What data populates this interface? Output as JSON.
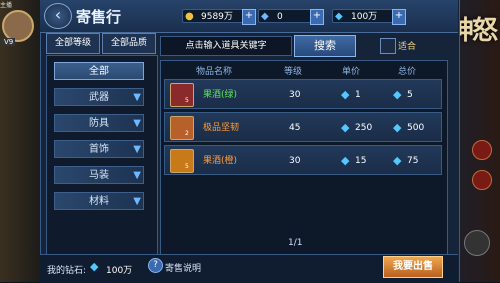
{
  "window": {
    "title": "寄售行"
  },
  "currencies": [
    {
      "icon": "gold-coin-icon",
      "value": "9589万"
    },
    {
      "icon": "blue-gem-icon",
      "value": "0"
    },
    {
      "icon": "diamond-icon",
      "value": "100万"
    }
  ],
  "filters": {
    "level": "全部等级",
    "quality": "全部品质"
  },
  "categories": [
    {
      "label": "全部",
      "selected": true
    },
    {
      "label": "武器"
    },
    {
      "label": "防具"
    },
    {
      "label": "首饰"
    },
    {
      "label": "马装"
    },
    {
      "label": "材料"
    }
  ],
  "search": {
    "placeholder": "点击输入道具关键字",
    "button": "搜索",
    "check_label": "适合"
  },
  "table": {
    "headers": [
      "物品名称",
      "等级",
      "单价",
      "总价"
    ],
    "rows": [
      {
        "name": "果酒(绿)",
        "level": "30",
        "unit": "1",
        "total": "5",
        "count": "5",
        "name_color": "#5ee05e",
        "icon_color": "#8a2a2a"
      },
      {
        "name": "极品坚韧",
        "level": "45",
        "unit": "250",
        "total": "500",
        "count": "2",
        "name_color": "#ff9a3a",
        "icon_color": "#b8602a"
      },
      {
        "name": "果酒(橙)",
        "level": "30",
        "unit": "15",
        "total": "75",
        "count": "5",
        "name_color": "#ff9a3a",
        "icon_color": "#c87a1a"
      }
    ]
  },
  "pager": "1/1",
  "bottom": {
    "my_diamond_label": "我的钻石:",
    "my_diamond_value": "100万",
    "help_label": "寄售说明",
    "sell_button": "我要出售"
  },
  "background": {
    "logo": "神怒",
    "level_badge": "V9",
    "chat_top": "主播"
  }
}
